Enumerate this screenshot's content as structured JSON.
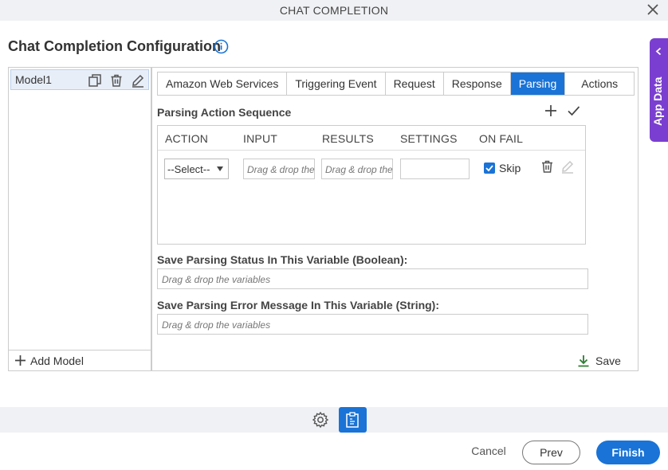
{
  "dialog": {
    "title": "CHAT COMPLETION",
    "heading": "Chat Completion Configuration"
  },
  "app_data_tab": {
    "label": "App Data"
  },
  "models": {
    "items": [
      {
        "name": "Model1"
      }
    ],
    "add_label": "Add Model"
  },
  "tabs": [
    {
      "label": "Amazon Web Services",
      "active": false
    },
    {
      "label": "Triggering Event",
      "active": false
    },
    {
      "label": "Request",
      "active": false
    },
    {
      "label": "Response",
      "active": false
    },
    {
      "label": "Parsing",
      "active": true
    },
    {
      "label": "Actions",
      "active": false
    }
  ],
  "parsing": {
    "sequence_label": "Parsing Action Sequence",
    "columns": [
      "ACTION",
      "INPUT",
      "RESULTS",
      "SETTINGS",
      "ON FAIL"
    ],
    "row": {
      "action_value": "--Select--",
      "input_placeholder": "Drag & drop the variables",
      "results_placeholder": "Drag & drop the variables",
      "settings_value": "",
      "on_fail_checked": true,
      "on_fail_label": "Skip"
    },
    "status_label": "Save Parsing Status In This Variable (Boolean):",
    "status_placeholder": "Drag & drop the variables",
    "error_label": "Save Parsing Error Message In This Variable (String):",
    "error_placeholder": "Drag & drop the variables",
    "save_label": "Save"
  },
  "footer": {
    "cancel": "Cancel",
    "prev": "Prev",
    "finish": "Finish"
  },
  "colors": {
    "accent": "#1a73d6",
    "app_data": "#7a3fd0",
    "save_icon": "#2e7d32"
  }
}
